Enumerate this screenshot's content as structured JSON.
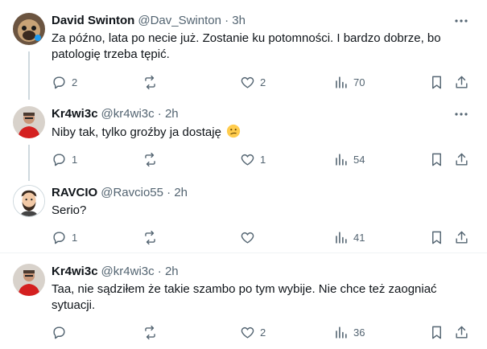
{
  "tweets": [
    {
      "name": "David Swinton",
      "handle": "@Dav_Swinton",
      "sep": "·",
      "time": "3h",
      "text": "Za późno, lata po necie już. Zostanie ku potomności. I bardzo dobrze, bo patologię trzeba tępić.",
      "replies": "2",
      "retweets": "",
      "likes": "2",
      "views": "70",
      "avatar": "pug-dog-avatar"
    },
    {
      "name": "Kr4wi3c",
      "handle": "@kr4wi3c",
      "sep": "·",
      "time": "2h",
      "text": "Niby tak, tylko groźby ja dostaję",
      "emoji": "confused-face-emoji",
      "replies": "1",
      "retweets": "",
      "likes": "1",
      "views": "54",
      "avatar": "red-shirt-person-avatar"
    },
    {
      "name": "RAVCIO",
      "handle": "@Ravcio55",
      "sep": "·",
      "time": "2h",
      "text": "Serio?",
      "replies": "1",
      "retweets": "",
      "likes": "",
      "views": "41",
      "avatar": "cartoon-bearded-man-avatar"
    },
    {
      "name": "Kr4wi3c",
      "handle": "@kr4wi3c",
      "sep": "·",
      "time": "2h",
      "text": "Taa, nie sądziłem że takie szambo po tym wybije. Nie chce też zaogniać sytuacji.",
      "replies": "",
      "retweets": "",
      "likes": "2",
      "views": "36",
      "avatar": "red-shirt-person-avatar"
    }
  ],
  "colors": {
    "secondary": "#536471",
    "primary": "#0f1419",
    "line": "#cfd9de"
  }
}
